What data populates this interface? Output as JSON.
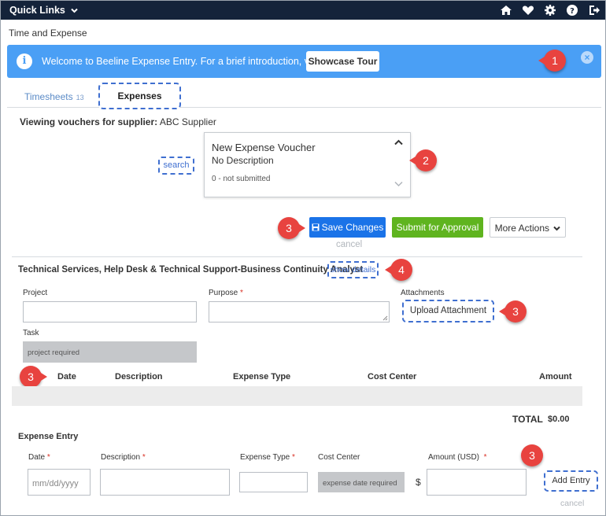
{
  "topbar": {
    "quick_links": "Quick Links",
    "icons": [
      "home-icon",
      "heart-icon",
      "gear-icon",
      "help-icon",
      "sign-out-icon"
    ]
  },
  "breadcrumb": "Time and Expense",
  "banner": {
    "message": "Welcome to Beeline Expense Entry. For a brief introduction, view the",
    "tour_button": "Showcase Tour",
    "color": "#4a9ff5"
  },
  "callouts": [
    "1",
    "2",
    "3",
    "3",
    "4",
    "3",
    "3",
    "3"
  ],
  "tabs": [
    {
      "label": "Timesheets",
      "count": "13"
    },
    {
      "label": "Expenses"
    }
  ],
  "supplier": {
    "label": "Viewing vouchers for supplier:",
    "value": "ABC Supplier"
  },
  "search_link": "search",
  "voucher": {
    "title": "New Expense Voucher",
    "description": "No Description",
    "status": "0 - not submitted"
  },
  "actions": {
    "save": "Save Changes",
    "submit": "Submit for Approval",
    "more": "More Actions",
    "cancel": "cancel"
  },
  "colors": {
    "save": "#1a73e8",
    "submit": "#5fb41f",
    "callout": "#e8433f",
    "dashed_outline": "#3f6fd0"
  },
  "section": {
    "title": "Technical Services, Help Desk & Technical Support-Business Continuity Analyst",
    "show_details": "show details"
  },
  "form": {
    "project_label": "Project",
    "purpose_label": "Purpose",
    "attachments_label": "Attachments",
    "upload_button": "Upload Attachment",
    "task_label": "Task",
    "task_placeholder": "project required",
    "required_mark": "*"
  },
  "table": {
    "columns": [
      "Date",
      "Description",
      "Expense Type",
      "Cost Center",
      "Amount"
    ],
    "total_label": "TOTAL",
    "total_value": "$0.00"
  },
  "entry": {
    "heading": "Expense Entry",
    "date_label": "Date",
    "description_label": "Description",
    "expense_type_label": "Expense Type",
    "cost_center_label": "Cost Center",
    "amount_label": "Amount (USD)",
    "date_placeholder": "mm/dd/yyyy",
    "cost_center_placeholder": "expense date required",
    "currency": "$",
    "add_button": "Add Entry",
    "cancel": "cancel"
  }
}
